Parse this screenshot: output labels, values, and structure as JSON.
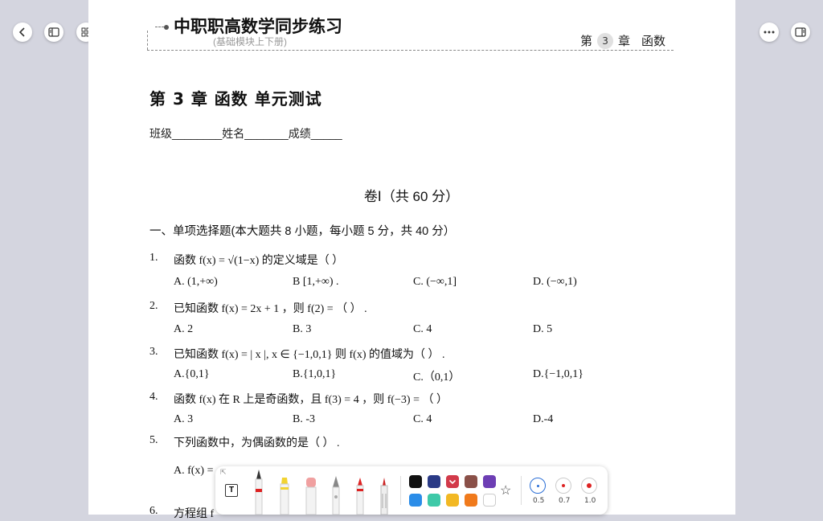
{
  "header": {
    "title": "中职职高数学同步练习",
    "subtitle": "(基础模块上下册)",
    "chapter_prefix": "第",
    "chapter_number": "3",
    "chapter_suffix": "章",
    "chapter_name": "函数"
  },
  "test": {
    "title": "第 3 章 函数 单元测试",
    "student_line": "班级________姓名_______成绩_____",
    "volume_title": "卷Ⅰ（共 60 分）",
    "section_title": "一、单项选择题(本大题共 8 小题，每小题 5 分，共 40 分）"
  },
  "questions": [
    {
      "num": "1.",
      "text": "函数 f(x) = √(1−x) 的定义域是（    ）",
      "options": [
        "A.  (1,+∞)",
        "B [1,+∞) .",
        "C.  (−∞,1]",
        "D. (−∞,1)"
      ]
    },
    {
      "num": "2.",
      "text": "已知函数 f(x) = 2x + 1 ，则 f(2) = （    ） .",
      "options": [
        "A. 2",
        "B. 3",
        "C. 4",
        "D. 5"
      ]
    },
    {
      "num": "3.",
      "text": "已知函数 f(x) = | x |, x ∈ {−1,0,1} 则 f(x) 的值域为（    ） .",
      "options": [
        "A.{0,1}",
        "B.{1,0,1}",
        "C.（0,1）",
        "D.{−1,0,1}"
      ]
    },
    {
      "num": "4.",
      "text": "函数 f(x) 在 R 上是奇函数，且 f(3) = 4 ，则 f(−3) = （    ）",
      "options": [
        "A. 3",
        "B.  -3",
        "C. 4",
        "D.-4"
      ]
    },
    {
      "num": "5.",
      "text": "下列函数中，为偶函数的是（    ） .",
      "options": [
        "A. f(x) ="
      ]
    },
    {
      "num": "6.",
      "text": "方程组 f",
      "options": []
    }
  ],
  "toolbar": {
    "colors_row1": [
      "#111111",
      "#2a3a86",
      "#d23a4a",
      "#8a5048",
      "#6d3eb4"
    ],
    "colors_row2": [
      "#2b8de8",
      "#3ec9a8",
      "#f2b824",
      "#f07a1c",
      "#ffffff"
    ],
    "sizes": [
      "0.5",
      "0.7",
      "1.0"
    ],
    "icons": [
      "text-tool-icon",
      "star-icon"
    ]
  },
  "nav_icons": [
    "back-icon",
    "sidebar-icon",
    "grid-icon",
    "undo-icon",
    "redo-icon",
    "more-icon",
    "reader-icon"
  ]
}
